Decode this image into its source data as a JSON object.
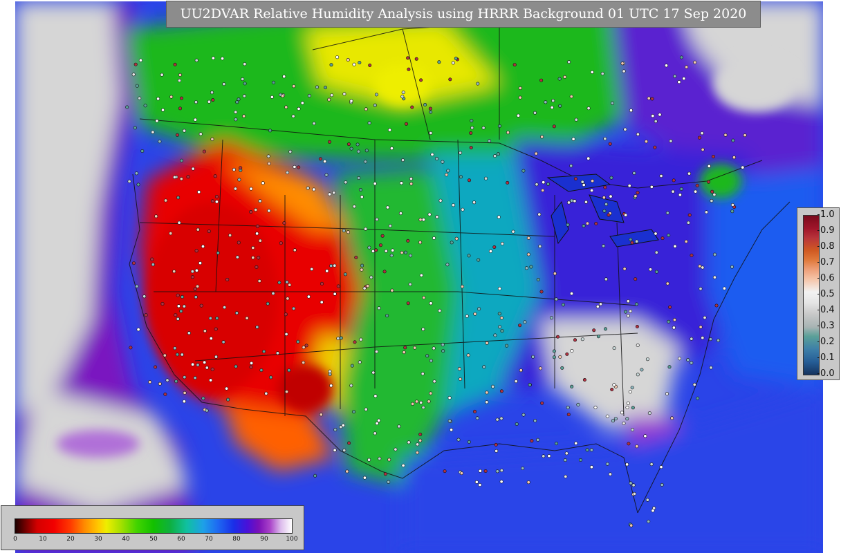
{
  "title": "UU2DVAR Relative Humidity Analysis using HRRR Background 01 UTC 17 Sep 2020",
  "colors": {
    "ocean": "#2a44e8",
    "dry": "#e60000",
    "moderate": "#1fb820",
    "humid": "#2038e6",
    "saturated": "#d4d4d4",
    "boundary": "#111111"
  },
  "station_legend": {
    "ticks": [
      "1.0",
      "0.9",
      "0.8",
      "0.7",
      "0.6",
      "0.5",
      "0.4",
      "0.3",
      "0.2",
      "0.1",
      "0.0"
    ]
  },
  "humidity_legend": {
    "ticks": [
      "0",
      "10",
      "20",
      "30",
      "40",
      "50",
      "60",
      "70",
      "80",
      "90",
      "100"
    ]
  }
}
